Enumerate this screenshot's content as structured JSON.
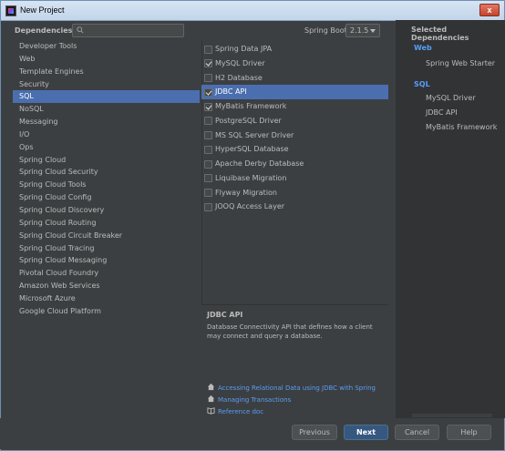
{
  "window": {
    "title": "New Project",
    "close_glyph": "x"
  },
  "header": {
    "dependencies_label": "Dependencies",
    "search_placeholder": "",
    "spring_boot_label": "Spring Boot",
    "spring_boot_version": "2.1.5",
    "selected_title": "Selected Dependencies"
  },
  "categories": [
    "Developer Tools",
    "Web",
    "Template Engines",
    "Security",
    "SQL",
    "NoSQL",
    "Messaging",
    "I/O",
    "Ops",
    "Spring Cloud",
    "Spring Cloud Security",
    "Spring Cloud Tools",
    "Spring Cloud Config",
    "Spring Cloud Discovery",
    "Spring Cloud Routing",
    "Spring Cloud Circuit Breaker",
    "Spring Cloud Tracing",
    "Spring Cloud Messaging",
    "Pivotal Cloud Foundry",
    "Amazon Web Services",
    "Microsoft Azure",
    "Google Cloud Platform"
  ],
  "selected_category_index": 4,
  "dependencies": [
    {
      "label": "Spring Data JPA",
      "checked": false
    },
    {
      "label": "MySQL Driver",
      "checked": true
    },
    {
      "label": "H2 Database",
      "checked": false
    },
    {
      "label": "JDBC API",
      "checked": true
    },
    {
      "label": "MyBatis Framework",
      "checked": true
    },
    {
      "label": "PostgreSQL Driver",
      "checked": false
    },
    {
      "label": "MS SQL Server Driver",
      "checked": false
    },
    {
      "label": "HyperSQL Database",
      "checked": false
    },
    {
      "label": "Apache Derby Database",
      "checked": false
    },
    {
      "label": "Liquibase Migration",
      "checked": false
    },
    {
      "label": "Flyway Migration",
      "checked": false
    },
    {
      "label": "JOOQ Access Layer",
      "checked": false
    }
  ],
  "selected_dependency_index": 3,
  "description": {
    "title": "JDBC API",
    "text": "Database Connectivity API that defines how a client may connect and query a database.",
    "links": [
      {
        "icon": "home-icon",
        "label": "Accessing Relational Data using JDBC with Spring"
      },
      {
        "icon": "home-icon",
        "label": "Managing Transactions"
      },
      {
        "icon": "book-icon",
        "label": "Reference doc"
      }
    ]
  },
  "selected": {
    "web_group": "Web",
    "web_items": [
      "Spring Web Starter"
    ],
    "sql_group": "SQL",
    "sql_items": [
      "MySQL Driver",
      "JDBC API",
      "MyBatis Framework"
    ]
  },
  "buttons": {
    "previous": "Previous",
    "next": "Next",
    "cancel": "Cancel",
    "help": "Help"
  },
  "colors": {
    "background": "#3c3f41",
    "selection": "#4b6eaf",
    "link": "#589df6",
    "primary_button": "#365880"
  }
}
